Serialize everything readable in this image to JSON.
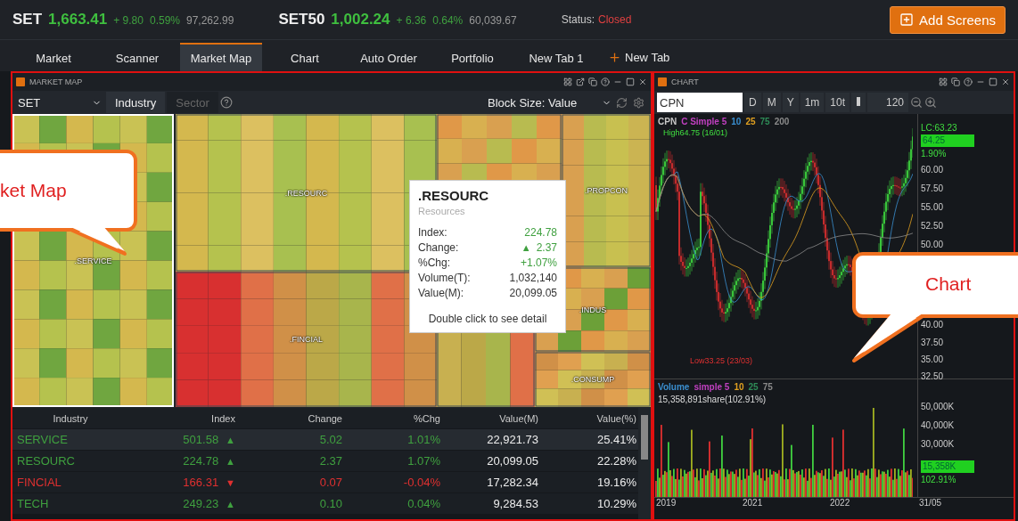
{
  "header": {
    "indices": [
      {
        "name": "SET",
        "value": "1,663.41",
        "change": "+ 9.80",
        "pct": "0.59%",
        "volume": "97,262.99"
      },
      {
        "name": "SET50",
        "value": "1,002.24",
        "change": "+ 6.36",
        "pct": "0.64%",
        "volume": "60,039.67"
      }
    ],
    "status_label": "Status:",
    "status": "Closed",
    "add_button": "Add Screens"
  },
  "tabs": [
    {
      "label": "Market",
      "selected": false
    },
    {
      "label": "Scanner",
      "selected": false
    },
    {
      "label": "Market Map",
      "selected": true
    },
    {
      "label": "Chart",
      "selected": false
    },
    {
      "label": "Auto Order",
      "selected": false
    },
    {
      "label": "Portfolio",
      "selected": false
    },
    {
      "label": "New Tab 1",
      "selected": false
    }
  ],
  "new_tab_button": "New Tab",
  "market_map": {
    "title": "MARKET MAP",
    "highlighted": true,
    "market": "SET",
    "modes": [
      {
        "label": "Industry",
        "selected": true
      },
      {
        "label": "Sector",
        "selected": false
      }
    ],
    "block_size": "Block Size: Value",
    "blocks": [
      {
        "label": ".SERVICE",
        "selected": true
      },
      {
        "label": ".RESOURC",
        "selected": false
      },
      {
        "label": ".FINCIAL",
        "selected": false
      },
      {
        "selected": false
      },
      {
        "label": ".PROPCON",
        "selected": false
      },
      {
        "selected": false
      },
      {
        "label": ".INDUS",
        "selected": false
      },
      {
        "label": ".CONSUMP",
        "selected": false
      }
    ],
    "tooltip": {
      "title": ".RESOURC",
      "subtitle": "Resources",
      "rows": [
        {
          "label": "Index:",
          "value": "224.78",
          "color": "#3fa03f"
        },
        {
          "label": "Change:",
          "value": "2.37",
          "color": "#3fa03f",
          "arrow": "▲"
        },
        {
          "label": "%Chg:",
          "value": "+1.07%",
          "color": "#3fa03f"
        },
        {
          "label": "Volume(T):",
          "value": "1,032,140",
          "color": "#333333"
        },
        {
          "label": "Value(M):",
          "value": "20,099.05",
          "color": "#333333"
        }
      ],
      "hint": "Double click to see detail"
    },
    "table": {
      "columns": [
        "Industry",
        "Index",
        "Change",
        "%Chg",
        "Value(M)",
        "Value(%)"
      ],
      "rows": [
        {
          "industry": "SERVICE",
          "index": "501.58",
          "arrow": "▲",
          "change": "5.02",
          "pct": "1.01%",
          "value_m": "22,921.73",
          "value_pct": "25.41%",
          "color": "#3fa03f",
          "selected": true
        },
        {
          "industry": "RESOURC",
          "index": "224.78",
          "arrow": "▲",
          "change": "2.37",
          "pct": "1.07%",
          "value_m": "20,099.05",
          "value_pct": "22.28%",
          "color": "#3fa03f",
          "selected": false
        },
        {
          "industry": "FINCIAL",
          "index": "166.31",
          "arrow": "▼",
          "change": "0.07",
          "pct": "-0.04%",
          "value_m": "17,282.34",
          "value_pct": "19.16%",
          "color": "#e03030",
          "selected": false
        },
        {
          "industry": "TECH",
          "index": "249.23",
          "arrow": "▲",
          "change": "0.10",
          "pct": "0.04%",
          "value_m": "9,284.53",
          "value_pct": "10.29%",
          "color": "#3fa03f",
          "selected": false
        }
      ]
    }
  },
  "chart": {
    "title": "CHART",
    "highlighted": true,
    "symbol": "CPN",
    "periods": [
      "D",
      "M",
      "Y",
      "1m",
      "10t"
    ],
    "bars": "120",
    "price_legend": [
      {
        "label": "CPN",
        "color": "#c8c8c8"
      },
      {
        "label": "C Simple 5",
        "color": "#c040c0"
      },
      {
        "label": "10",
        "color": "#3a8fd0"
      },
      {
        "label": "25",
        "color": "#e0a020"
      },
      {
        "label": "75",
        "color": "#2e8b57"
      },
      {
        "label": "200",
        "color": "#8a8a8a"
      }
    ],
    "high_label": "High64.75 (16/01)",
    "low_label": "Low33.25 (23/03)",
    "last_close": "LC:63.23",
    "last_price": "64.25",
    "last_change": "1.90%",
    "price_ticks": [
      "60.00",
      "57.50",
      "55.00",
      "52.50",
      "50.00",
      "40.00",
      "37.50",
      "35.00",
      "32.50"
    ],
    "volume_legend": [
      {
        "label": "Volume",
        "color": "#3a8fd0"
      },
      {
        "label": "simple 5",
        "color": "#c040c0"
      },
      {
        "label": "10",
        "color": "#e0a020"
      },
      {
        "label": "25",
        "color": "#2e8b57"
      },
      {
        "label": "75",
        "color": "#8a8a8a"
      }
    ],
    "volume_readout": "15,358,891share(102.91%)",
    "volume_ticks": [
      "50,000K",
      "40,000K",
      "30,000K"
    ],
    "last_volume": "15,358K",
    "last_volume_pct": "102.91%",
    "x_ticks": [
      "2019",
      "2021",
      "2022"
    ],
    "last_date": "31/05"
  },
  "annotations": [
    {
      "kind": "map",
      "text": "ket Map"
    },
    {
      "kind": "chart",
      "text": "Chart"
    }
  ]
}
